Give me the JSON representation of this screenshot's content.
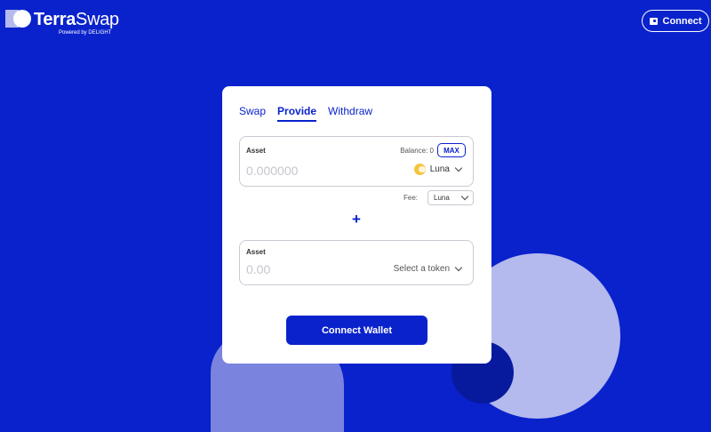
{
  "header": {
    "logo_terra": "Terra",
    "logo_swap": "Swap",
    "logo_sub": "Powered by DELIGHT",
    "connect_label": "Connect"
  },
  "tabs": [
    {
      "label": "Swap",
      "active": false
    },
    {
      "label": "Provide",
      "active": true
    },
    {
      "label": "Withdraw",
      "active": false
    }
  ],
  "asset1": {
    "label": "Asset",
    "balance": "Balance: 0",
    "max_label": "MAX",
    "amount_placeholder": "0.000000",
    "token": "Luna"
  },
  "fee": {
    "label": "Fee:",
    "selected": "Luna"
  },
  "plus_symbol": "+",
  "asset2": {
    "label": "Asset",
    "amount_placeholder": "0.00",
    "token": "Select a token"
  },
  "connect_wallet_label": "Connect Wallet",
  "colors": {
    "background": "#0a22cc",
    "accent": "#0a22cc",
    "card": "#ffffff"
  },
  "icons": {
    "logo": "terraswap-logo-icon",
    "wallet": "wallet-icon",
    "luna": "luna-icon",
    "chevron": "chevron-down-icon"
  }
}
